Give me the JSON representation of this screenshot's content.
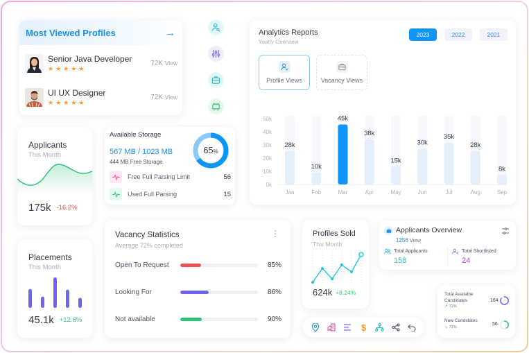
{
  "most_viewed": {
    "title": "Most Viewed Profiles",
    "arrow_icon": "arrow-right-icon",
    "profiles": [
      {
        "name": "Senior Java Developer",
        "rating": 5,
        "stars": "★★★★★",
        "views": "72K",
        "views_unit": "View"
      },
      {
        "name": "UI UX Designer",
        "rating": 5,
        "stars": "★★★★★",
        "views": "72K",
        "views_unit": "View"
      }
    ]
  },
  "side_icons": [
    "user-search-icon",
    "sliders-icon",
    "briefcase-icon",
    "card-icon"
  ],
  "analytics": {
    "title": "Analytics Reports",
    "subtitle": "Yearly Overview",
    "years": [
      "2023",
      "2022",
      "2021"
    ],
    "active_year": "2023",
    "tabs": [
      {
        "label": "Profile Views",
        "active": true
      },
      {
        "label": "Vacancy Views",
        "active": false
      }
    ]
  },
  "chart_data": {
    "type": "bar",
    "title": "Analytics Reports",
    "subtitle": "Yearly Overview",
    "categories": [
      "Jan",
      "Feb",
      "Mar",
      "Apr",
      "May",
      "Jun",
      "Jul",
      "Aug",
      "Sep"
    ],
    "values": [
      28,
      10,
      45,
      38,
      15,
      30,
      35,
      28,
      8
    ],
    "data_labels": [
      "28k",
      "10k",
      "45k",
      "38k",
      "15k",
      "30k",
      "35k",
      "28k",
      "8k"
    ],
    "highlight": "Mar",
    "ylim": [
      0,
      50
    ],
    "yticks": [
      "0k",
      "10k",
      "20k",
      "30k",
      "40k",
      "50k"
    ],
    "ytick_values": [
      0,
      10,
      20,
      30,
      40,
      50
    ],
    "unit": "k",
    "colors": {
      "bar": "#e3effb",
      "highlight": "#0f95f8",
      "track": "#f6f8fb"
    }
  },
  "applicants": {
    "title": "Applicants",
    "subtitle": "This Month",
    "value": "175k",
    "change": "-16.2%",
    "change_color": "#e2504c"
  },
  "storage": {
    "title": "Available Storage",
    "used": "567 MB / 1023 MB",
    "free": "444 MB Free Storage",
    "percent": 65,
    "percent_label": "65",
    "percent_sign": "%",
    "rows": [
      {
        "icon": "pulse-icon",
        "label": "Free Full Parsing Limit",
        "value": "56"
      },
      {
        "icon": "pulse-icon",
        "label": "Used Full Parsing",
        "value": "15"
      }
    ]
  },
  "placements": {
    "title": "Placements",
    "subtitle": "This Month",
    "value": "45.1k",
    "change": "+12.6%",
    "change_color": "#3cc47a",
    "bars": [
      0.62,
      0.37,
      1.0,
      0.6,
      0.33
    ]
  },
  "vacancy": {
    "title": "Vacancy Statistics",
    "subtitle": "Average 72% completed",
    "menu_icon": "more-vertical-icon",
    "rows": [
      {
        "label": "Open To Request",
        "percent": "85%",
        "fill": 0.27,
        "color": "#ea5455"
      },
      {
        "label": "Looking For",
        "percent": "86%",
        "fill": 0.37,
        "color": "#6f64f0"
      },
      {
        "label": "Not available",
        "percent": "90%",
        "fill": 0.28,
        "color": "#28c76f"
      }
    ]
  },
  "profiles_sold": {
    "title": "Profiles Sold",
    "subtitle": "This Month",
    "value": "624k",
    "change": "+8.24%",
    "change_color": "#3cc47a",
    "series": [
      1,
      5,
      2,
      6,
      4,
      9
    ]
  },
  "applicants_overview": {
    "title": "Applicants Overview",
    "views_count": "1256",
    "views_unit": "View",
    "total_applicants_label": "Total Applicants",
    "total_applicants": "158",
    "total_shortlisted_label": "Total Shortlisted",
    "total_shortlisted": "24"
  },
  "candidates": [
    {
      "label_line1": "Total Available",
      "label_line2": "Candidates",
      "trend": "71%",
      "value": "164",
      "ring_color": "#6f64f0",
      "ring_fill": 0.85
    },
    {
      "label_line1": "New Candidates",
      "label_line2": "",
      "trend": "71%",
      "value": "56",
      "ring_color": "#28c76f",
      "ring_fill": 0.4
    }
  ],
  "toolbar": {
    "icons": [
      "location-pin-icon",
      "building-icon",
      "align-left-icon",
      "dollar-icon",
      "hierarchy-icon",
      "share-icon",
      "undo-icon"
    ]
  }
}
